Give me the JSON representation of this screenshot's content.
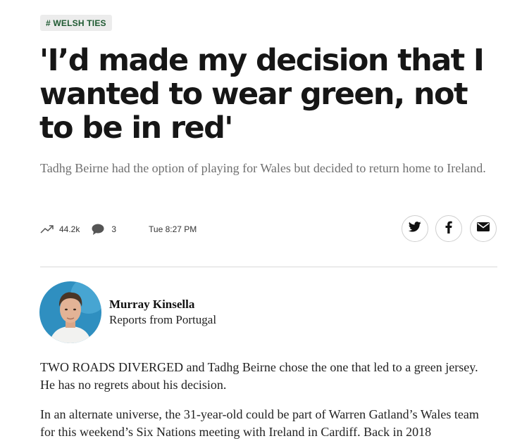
{
  "article": {
    "tag": "# WELSH TIES",
    "headline": "'I’d made my decision that I wanted to wear green, not to be in red'",
    "standfirst": "Tadhg Beirne had the option of playing for Wales but decided to return home to Ireland.",
    "meta": {
      "trend_icon": "trending-up-icon",
      "views": "44.2k",
      "comment_icon": "comment-bubble-icon",
      "comments": "3",
      "time": "Tue 8:27 PM"
    },
    "share": [
      {
        "icon": "twitter-icon",
        "label": "Share on Twitter"
      },
      {
        "icon": "facebook-icon",
        "label": "Share on Facebook"
      },
      {
        "icon": "email-icon",
        "label": "Share by email"
      }
    ],
    "author": {
      "name": "Murray Kinsella",
      "role": "Reports from Portugal"
    },
    "body": [
      "TWO ROADS DIVERGED and Tadhg Beirne chose the one that led to a green jersey. He has no regrets about his decision.",
      "In an alternate universe, the 31-year-old could be part of Warren Gatland’s Wales team for this weekend’s Six Nations meeting with Ireland in Cardiff. Back in 2018"
    ]
  },
  "colors": {
    "tag_text": "#1f5a32",
    "tag_bg": "#ececec",
    "headline": "#161616",
    "standfirst": "#6f6f6f",
    "avatar_bg": "#2f8fc0"
  }
}
